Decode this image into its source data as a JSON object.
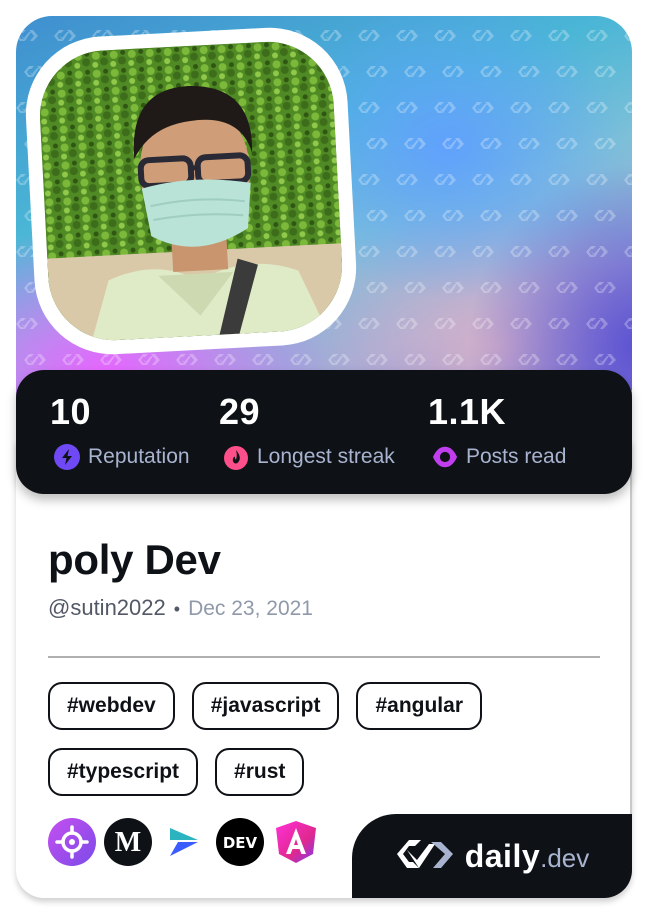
{
  "profile": {
    "name": "poly Dev",
    "handle": "@sutin2022",
    "separator": "•",
    "joined": "Dec 23, 2021"
  },
  "stats": [
    {
      "value": "10",
      "label": "Reputation",
      "icon": "lightning-icon",
      "color": "#6e49f4"
    },
    {
      "value": "29",
      "label": "Longest streak",
      "icon": "flame-icon",
      "color": "#ff4f8b"
    },
    {
      "value": "1.1K",
      "label": "Posts read",
      "icon": "eye-icon",
      "color": "#c13eee"
    }
  ],
  "tags": [
    "#webdev",
    "#javascript",
    "#angular",
    "#typescript",
    "#rust"
  ],
  "sources": [
    {
      "name": "crosshair-source-icon",
      "color": "#b64ee8"
    },
    {
      "name": "medium-source-icon",
      "color": "#0e1217"
    },
    {
      "name": "arrow-source-icon",
      "color": "#3b5cff"
    },
    {
      "name": "dev-to-source-icon",
      "color": "#000000"
    },
    {
      "name": "angular-source-icon",
      "color": "#e0288f"
    }
  ],
  "brand": {
    "primary": "daily",
    "secondary": ".dev"
  },
  "colors": {
    "dark": "#0e1217",
    "label": "#a8b3cf",
    "handle": "#525866",
    "joined": "#9099aa"
  }
}
